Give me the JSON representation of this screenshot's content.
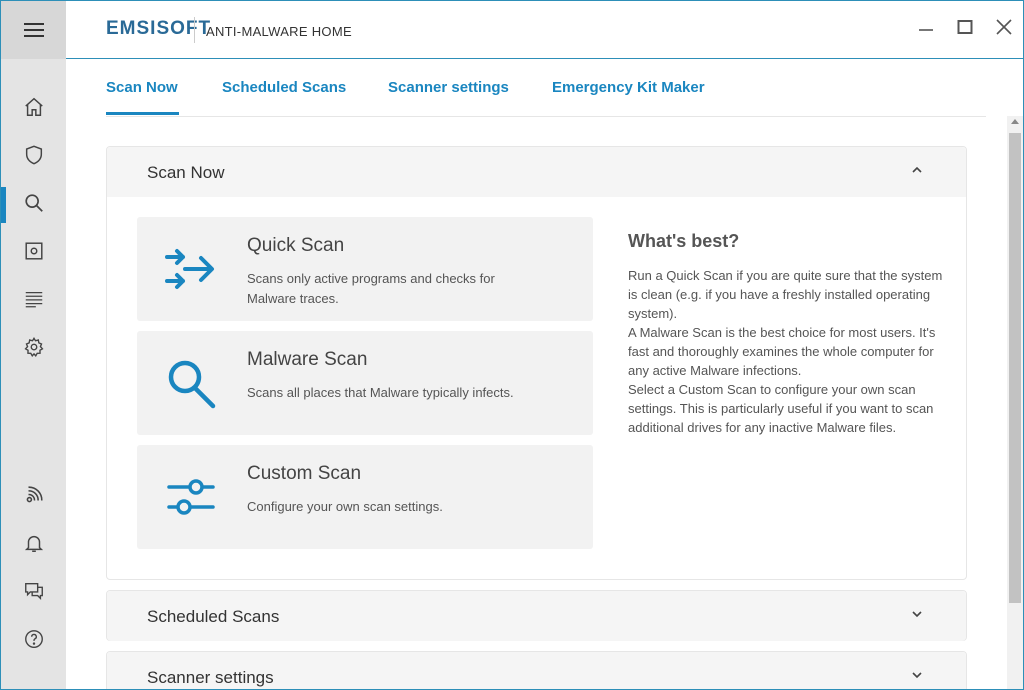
{
  "app": {
    "brand": "EMSISOFT",
    "product": "ANTI-MALWARE HOME"
  },
  "sidebar": {
    "icons": [
      "menu-icon",
      "home-icon",
      "shield-icon",
      "search-icon",
      "quarantine-icon",
      "logs-icon",
      "settings-icon",
      "network-icon",
      "bell-icon",
      "chat-icon",
      "help-icon"
    ],
    "active": "search-icon",
    "accent": "#1a86c0"
  },
  "tabs": [
    {
      "label": "Scan Now",
      "active": true
    },
    {
      "label": "Scheduled Scans",
      "active": false
    },
    {
      "label": "Scanner settings",
      "active": false
    },
    {
      "label": "Emergency Kit Maker",
      "active": false
    }
  ],
  "scan_panel": {
    "title": "Scan Now",
    "cards": [
      {
        "title": "Quick Scan",
        "description": "Scans only active programs and checks for Malware traces.",
        "icon": "quick-scan-arrows-icon"
      },
      {
        "title": "Malware Scan",
        "description": "Scans all places that Malware typically infects.",
        "icon": "magnifier-icon"
      },
      {
        "title": "Custom Scan",
        "description": "Configure your own scan settings.",
        "icon": "sliders-icon"
      }
    ],
    "best": {
      "title": "What's best?",
      "paragraphs": [
        "Run a Quick Scan if you are quite sure that the system is clean (e.g. if you have a freshly installed operating system).",
        "A Malware Scan is the best choice for most users. It's fast and thoroughly examines the whole computer for any active Malware infections.",
        "Select a Custom Scan to configure your own scan settings. This is particularly useful if you want to scan additional drives for any inactive Malware files."
      ]
    }
  },
  "collapsed_panels": [
    {
      "title": "Scheduled Scans"
    },
    {
      "title": "Scanner settings"
    }
  ],
  "colors": {
    "accent": "#1a86c0",
    "brand": "#2a6a97"
  }
}
